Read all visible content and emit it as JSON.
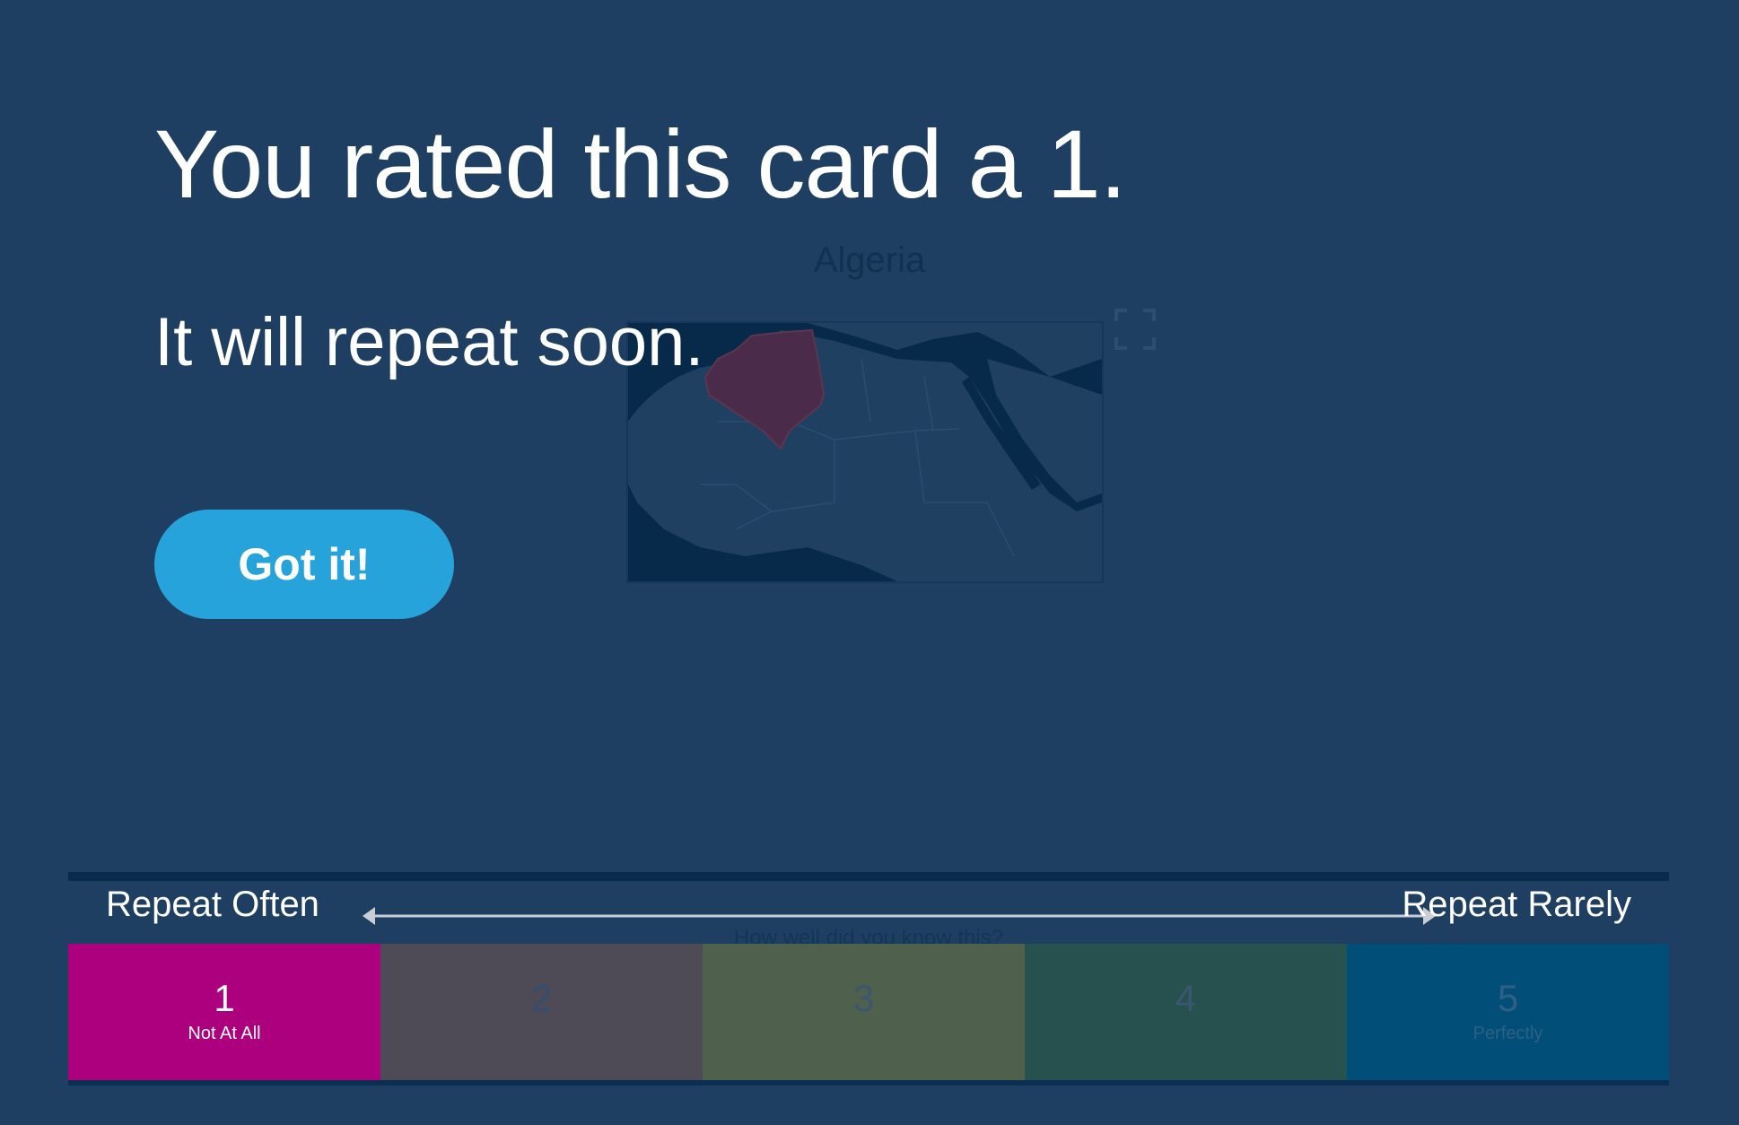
{
  "card": {
    "title": "Algeria",
    "expand_icon": "expand-icon"
  },
  "overlay": {
    "headline": "You rated this card a 1.",
    "subline": "It will repeat soon.",
    "button_label": "Got it!"
  },
  "rating": {
    "left_label": "Repeat Often",
    "right_label": "Repeat Rarely",
    "question": "How well did you know this?",
    "options": [
      {
        "number": "1",
        "label": "Not At All",
        "color": "#ac007f"
      },
      {
        "number": "2",
        "label": "",
        "color": "#4e4a56"
      },
      {
        "number": "3",
        "label": "",
        "color": "#4f614d"
      },
      {
        "number": "4",
        "label": "",
        "color": "#26514f"
      },
      {
        "number": "5",
        "label": "Perfectly",
        "color": "#014f78"
      }
    ],
    "selected": "1"
  },
  "colors": {
    "background": "#1f3f62",
    "accent_button": "#27a3dc",
    "map_water": "#07294a",
    "map_land": "#1f4060",
    "highlight_country": "#4a2b4a"
  }
}
